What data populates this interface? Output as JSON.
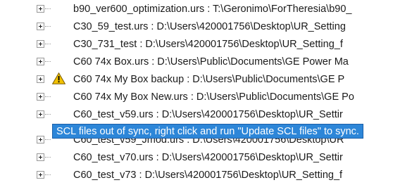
{
  "tree": {
    "items": [
      {
        "label": "b90_ver600_optimization.urs : T:\\Geronimo\\ForTheresia\\b90_"
      },
      {
        "label": "C30_59_test.urs : D:\\Users\\420001756\\Desktop\\UR_Setting"
      },
      {
        "label": "C30_731_test : D:\\Users\\420001756\\Desktop\\UR_Setting_f"
      },
      {
        "label": "C60 74x Box.urs : D:\\Users\\Public\\Documents\\GE Power Ma"
      },
      {
        "label": "C60 74x My Box backup : D:\\Users\\Public\\Documents\\GE P",
        "warning": true
      },
      {
        "label": "C60 74x My Box New.urs : D:\\Users\\Public\\Documents\\GE Po"
      },
      {
        "label": "C60_test_v59.urs : D:\\Users\\420001756\\Desktop\\UR_Settir"
      },
      {
        "label": "C60_test_v59_Jmod.urs : D:\\Users\\420001756\\Desktop\\UR"
      },
      {
        "label": "C60_test_v70.urs : D:\\Users\\420001756\\Desktop\\UR_Settir"
      },
      {
        "label": "C60_test_v73 : D:\\Users\\420001756\\Desktop\\UR_Setting_f"
      }
    ],
    "icons": {
      "expander": "plus-box-icon",
      "warning": "warning-triangle-icon"
    }
  },
  "tooltip": {
    "text": "SCL files out of sync, right click and run \"Update SCL files\" to sync."
  },
  "colors": {
    "tooltip_bg": "#2d86d8",
    "warning_fill": "#f2c200"
  }
}
